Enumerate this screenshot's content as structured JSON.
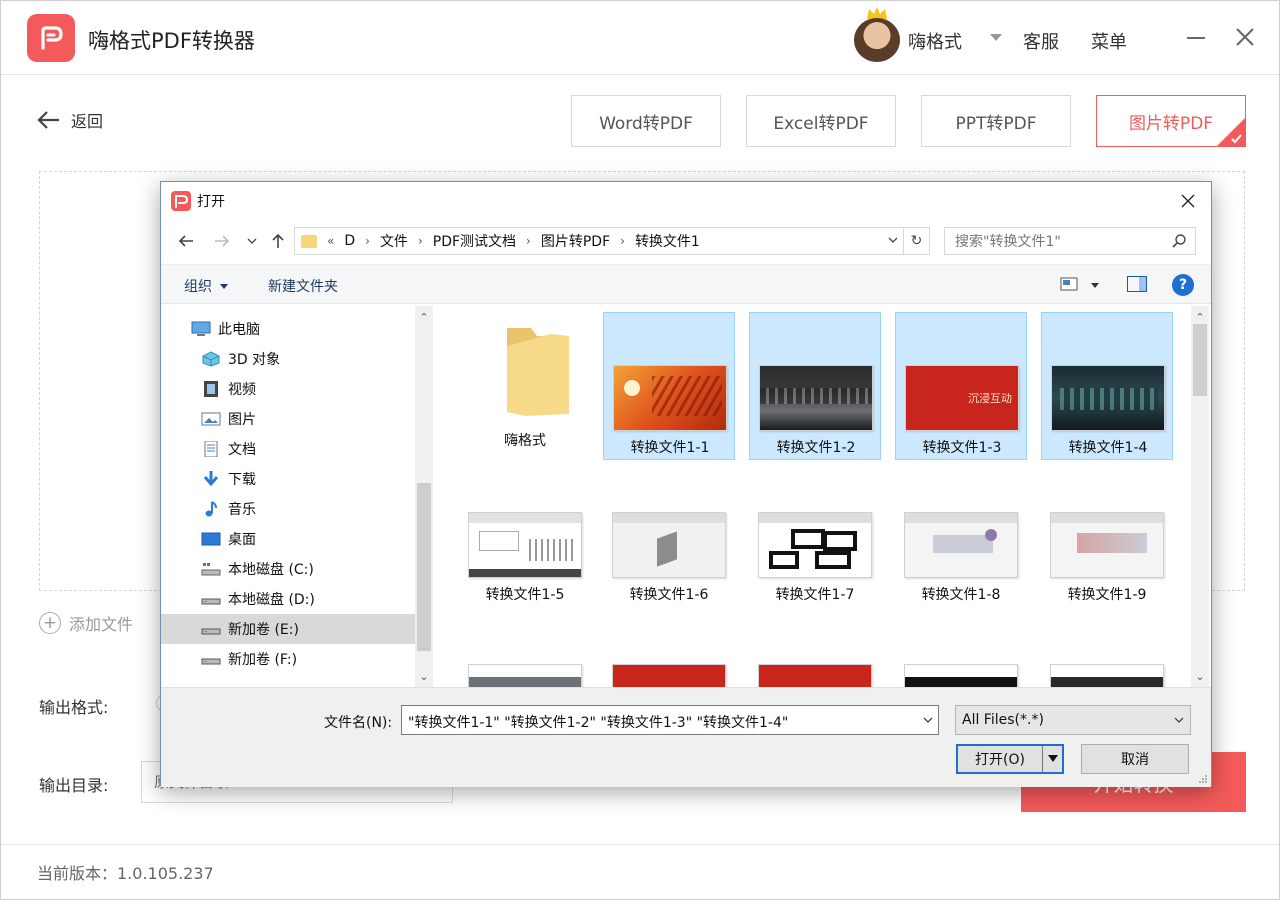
{
  "app": {
    "title": "嗨格式PDF转换器",
    "user_name": "嗨格式",
    "kefu": "客服",
    "menu": "菜单",
    "back_label": "返回",
    "tabs": [
      {
        "label": "Word转PDF",
        "active": false
      },
      {
        "label": "Excel转PDF",
        "active": false
      },
      {
        "label": "PPT转PDF",
        "active": false
      },
      {
        "label": "图片转PDF",
        "active": true
      }
    ],
    "add_file": "添加文件",
    "output_format_label": "输出格式:",
    "output_dir_label": "输出目录:",
    "output_dir_placeholder": "原文件目录",
    "start_button": "开始转换",
    "version": "当前版本：1.0.105.237",
    "accent": "#f55a5a"
  },
  "dialog": {
    "title": "打开",
    "breadcrumb": [
      "D",
      "文件",
      "PDF测试文档",
      "图片转PDF",
      "转换文件1"
    ],
    "breadcrumb_prefix": "«",
    "search_placeholder": "搜索\"转换文件1\"",
    "toolbar": {
      "organize": "组织",
      "new_folder": "新建文件夹"
    },
    "nav_items": [
      {
        "label": "此电脑",
        "icon": "computer-icon"
      },
      {
        "label": "3D 对象",
        "icon": "cube-3d-icon"
      },
      {
        "label": "视频",
        "icon": "video-icon"
      },
      {
        "label": "图片",
        "icon": "picture-icon"
      },
      {
        "label": "文档",
        "icon": "document-icon"
      },
      {
        "label": "下载",
        "icon": "download-icon"
      },
      {
        "label": "音乐",
        "icon": "music-icon"
      },
      {
        "label": "桌面",
        "icon": "desktop-icon"
      },
      {
        "label": "本地磁盘 (C:)",
        "icon": "drive-c-icon"
      },
      {
        "label": "本地磁盘 (D:)",
        "icon": "drive-icon"
      },
      {
        "label": "新加卷 (E:)",
        "icon": "drive-icon",
        "selected": true
      },
      {
        "label": "新加卷 (F:)",
        "icon": "drive-icon"
      }
    ],
    "files": [
      {
        "name": "嗨格式",
        "kind": "folder",
        "selected": false
      },
      {
        "name": "转换文件1-1",
        "kind": "image",
        "selected": true
      },
      {
        "name": "转换文件1-2",
        "kind": "image",
        "selected": true
      },
      {
        "name": "转换文件1-3",
        "kind": "image",
        "selected": true,
        "thumb_text": "沉浸互动"
      },
      {
        "name": "转换文件1-4",
        "kind": "image",
        "selected": true
      },
      {
        "name": "转换文件1-5",
        "kind": "image",
        "selected": false
      },
      {
        "name": "转换文件1-6",
        "kind": "image",
        "selected": false
      },
      {
        "name": "转换文件1-7",
        "kind": "image",
        "selected": false
      },
      {
        "name": "转换文件1-8",
        "kind": "image",
        "selected": false
      },
      {
        "name": "转换文件1-9",
        "kind": "image",
        "selected": false
      }
    ],
    "filename_label": "文件名(N):",
    "filename_value": "\"转换文件1-1\" \"转换文件1-2\" \"转换文件1-3\" \"转换文件1-4\"",
    "filetype": "All Files(*.*)",
    "open_button": "打开(O)",
    "cancel_button": "取消"
  }
}
